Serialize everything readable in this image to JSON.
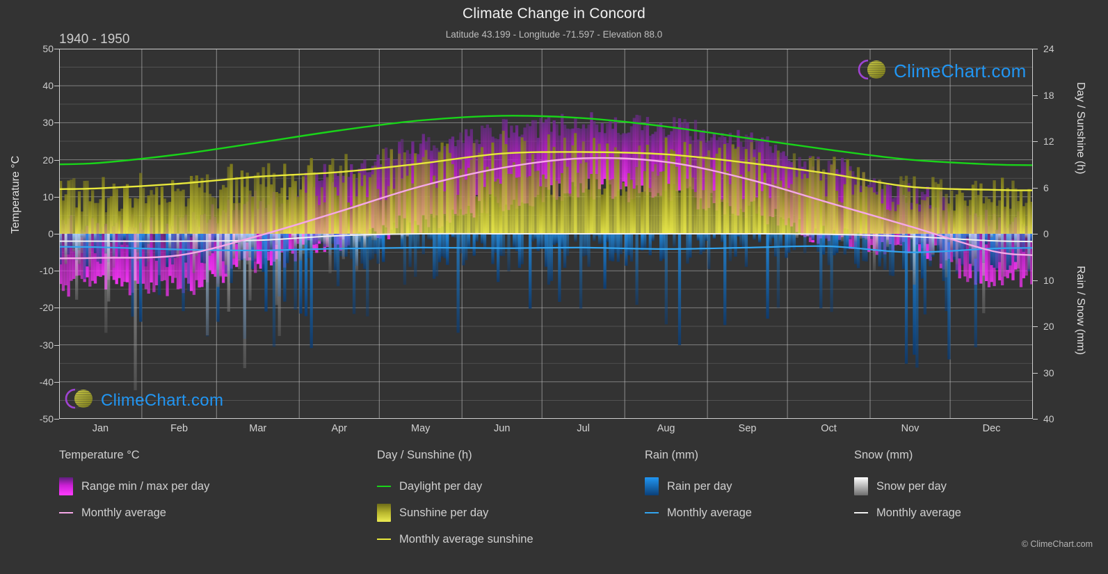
{
  "header": {
    "title": "Climate Change in Concord",
    "subtitle": "Latitude 43.199 - Longitude -71.597 - Elevation 88.0",
    "period": "1940 - 1950"
  },
  "watermark": {
    "text": "ClimeChart.com"
  },
  "footer": {
    "copyright": "© ClimeChart.com"
  },
  "axes": {
    "left_title": "Temperature °C",
    "right_top_title": "Day / Sunshine (h)",
    "right_bottom_title": "Rain / Snow (mm)",
    "left_ticks": [
      "50",
      "40",
      "30",
      "20",
      "10",
      "0",
      "-10",
      "-20",
      "-30",
      "-40",
      "-50"
    ],
    "right_top_ticks": [
      "24",
      "18",
      "12",
      "6",
      "0"
    ],
    "right_bottom_ticks": [
      "0",
      "10",
      "20",
      "30",
      "40"
    ],
    "x_ticks": [
      "Jan",
      "Feb",
      "Mar",
      "Apr",
      "May",
      "Jun",
      "Jul",
      "Aug",
      "Sep",
      "Oct",
      "Nov",
      "Dec"
    ]
  },
  "legend": {
    "temperature": {
      "heading": "Temperature °C",
      "items": [
        {
          "label": "Range min / max per day",
          "swatch": "gradient-magenta",
          "color": "#e619e6"
        },
        {
          "label": "Monthly average",
          "swatch": "line",
          "color": "#f5a8e8"
        }
      ]
    },
    "daysun": {
      "heading": "Day / Sunshine (h)",
      "items": [
        {
          "label": "Daylight per day",
          "swatch": "line",
          "color": "#19d419"
        },
        {
          "label": "Sunshine per day",
          "swatch": "gradient-yellow",
          "color": "#e8e83c"
        },
        {
          "label": "Monthly average sunshine",
          "swatch": "line",
          "color": "#e8e83c"
        }
      ]
    },
    "rain": {
      "heading": "Rain (mm)",
      "items": [
        {
          "label": "Rain per day",
          "swatch": "gradient-blue",
          "color": "#1989e6"
        },
        {
          "label": "Monthly average",
          "swatch": "line",
          "color": "#33a5ef"
        }
      ]
    },
    "snow": {
      "heading": "Snow (mm)",
      "items": [
        {
          "label": "Snow per day",
          "swatch": "gradient-white",
          "color": "#e8e8e8"
        },
        {
          "label": "Monthly average",
          "swatch": "line",
          "color": "#f0f0f0"
        }
      ]
    }
  },
  "chart_data": {
    "type": "line",
    "title": "Climate Change in Concord",
    "subtitle": "Latitude 43.199 - Longitude -71.597 - Elevation 88.0",
    "period": "1940 - 1950",
    "xlabel": "",
    "ylabel": "Temperature °C",
    "ylim": [
      -50,
      50
    ],
    "y2_top_label": "Day / Sunshine (h)",
    "y2_top_lim": [
      0,
      24
    ],
    "y2_bottom_label": "Rain / Snow (mm)",
    "y2_bottom_lim": [
      0,
      40
    ],
    "grid": true,
    "legend_position": "below",
    "categories": [
      "Jan",
      "Feb",
      "Mar",
      "Apr",
      "May",
      "Jun",
      "Jul",
      "Aug",
      "Sep",
      "Oct",
      "Nov",
      "Dec"
    ],
    "series": [
      {
        "name": "Daylight per day",
        "unit": "h",
        "color": "#19d419",
        "values": [
          9.2,
          10.3,
          11.8,
          13.4,
          14.7,
          15.3,
          15.0,
          13.9,
          12.4,
          10.9,
          9.6,
          9.0
        ]
      },
      {
        "name": "Monthly average sunshine",
        "unit": "h",
        "color": "#e8e83c",
        "values": [
          5.9,
          6.5,
          7.4,
          8.0,
          9.1,
          10.4,
          10.6,
          10.3,
          9.2,
          7.8,
          6.1,
          5.7
        ]
      },
      {
        "name": "Monthly average temperature",
        "unit": "°C",
        "color": "#f5a8e8",
        "values": [
          -6.5,
          -5.8,
          -0.6,
          6.0,
          12.8,
          17.8,
          20.4,
          19.4,
          14.8,
          8.4,
          2.0,
          -4.6
        ]
      },
      {
        "name": "Monthly average rain",
        "unit": "mm",
        "color": "#33a5ef",
        "values": [
          2.9,
          3.4,
          3.6,
          3.2,
          3.0,
          3.1,
          3.0,
          3.3,
          3.0,
          2.7,
          4.0,
          3.2
        ]
      },
      {
        "name": "Monthly average snow",
        "unit": "mm",
        "color": "#f0f0f0",
        "values": [
          1.6,
          1.6,
          1.4,
          0.4,
          0.0,
          0.0,
          0.0,
          0.0,
          0.0,
          0.1,
          0.6,
          1.5
        ]
      }
    ],
    "daily_ranges": {
      "name": "Range min / max per day (°C)",
      "color": "#e619e6",
      "monthly_max": [
        2,
        3,
        9,
        17,
        24,
        28,
        30,
        29,
        25,
        18,
        11,
        4
      ],
      "monthly_min": [
        -14,
        -14,
        -8,
        -2,
        3,
        9,
        12,
        11,
        6,
        -1,
        -4,
        -12
      ]
    }
  }
}
